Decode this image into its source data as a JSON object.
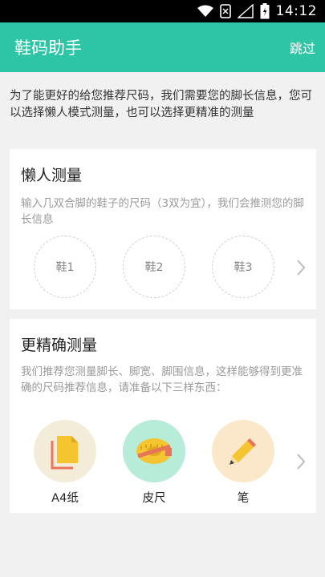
{
  "status": {
    "time": "14:12"
  },
  "appbar": {
    "title": "鞋码助手",
    "skip": "跳过"
  },
  "intro": "为了能更好的给您推荐尺码，我们需要您的脚长信息，您可以选择懒人模式测量，也可以选择更精准的测量",
  "lazy": {
    "title": "懒人测量",
    "desc": "输入几双合脚的鞋子的尺码（3双为宜），我们会推测您的脚长信息",
    "shoes": [
      "鞋1",
      "鞋2",
      "鞋3"
    ]
  },
  "precise": {
    "title": "更精确测量",
    "desc": "我们推荐您测量脚长、脚宽、脚围信息，这样能够得到更准确的尺码推荐信息，请准备以下三样东西：",
    "tools": [
      {
        "label": "A4纸",
        "icon": "paper-icon",
        "bg": "#f3ecd9"
      },
      {
        "label": "皮尺",
        "icon": "tape-measure-icon",
        "bg": "#b7ecd9"
      },
      {
        "label": "笔",
        "icon": "pencil-icon",
        "bg": "#fbe7c9"
      }
    ]
  },
  "colors": {
    "accent": "#2ec5a6"
  }
}
